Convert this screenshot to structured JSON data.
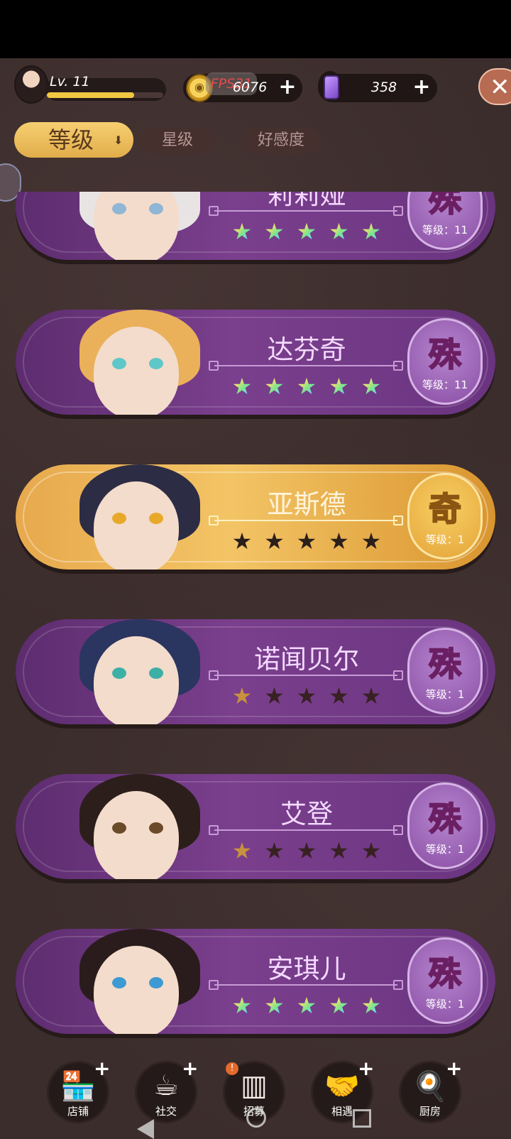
{
  "hud": {
    "level_text": "Lv. 11",
    "exp_fraction": 0.75,
    "fps_text": "FPS31",
    "coins": "6076",
    "gems": "358",
    "plus": "+",
    "close": "✕"
  },
  "sort_tabs": {
    "active": "等级",
    "active_arrow": "⬇",
    "star": "星级",
    "affinity": "好感度"
  },
  "characters": [
    {
      "name": "莉莉娅",
      "rank": "殊",
      "level_label": "等级：11",
      "stars_filled": 5,
      "star_type": "rainbow",
      "theme": "purple",
      "hair": "#e8e4e4",
      "eye": "#8fb6d4"
    },
    {
      "name": "达芬奇",
      "rank": "殊",
      "level_label": "等级：11",
      "stars_filled": 5,
      "star_type": "rainbow",
      "theme": "purple",
      "hair": "#eab15a",
      "eye": "#5fc7c7"
    },
    {
      "name": "亚斯德",
      "rank": "奇",
      "level_label": "等级：1",
      "stars_filled": 0,
      "star_type": "bronze",
      "theme": "gold",
      "hair": "#2c2c44",
      "eye": "#e8a92a"
    },
    {
      "name": "诺闻贝尔",
      "rank": "殊",
      "level_label": "等级：1",
      "stars_filled": 1,
      "star_type": "bronze",
      "theme": "purple",
      "hair": "#2a3560",
      "eye": "#3db0a6"
    },
    {
      "name": "艾登",
      "rank": "殊",
      "level_label": "等级：1",
      "stars_filled": 1,
      "star_type": "bronze",
      "theme": "purple",
      "hair": "#2c1e1a",
      "eye": "#6b4a2a"
    },
    {
      "name": "安琪儿",
      "rank": "殊",
      "level_label": "等级：1",
      "stars_filled": 5,
      "star_type": "rainbow",
      "theme": "purple",
      "hair": "#2a1c1c",
      "eye": "#3e9ad2"
    }
  ],
  "nav": [
    {
      "label": "店铺",
      "glyph": "🏪",
      "plus": "+"
    },
    {
      "label": "社交",
      "glyph": "☕",
      "plus": "+"
    },
    {
      "label": "招募",
      "glyph": "▥",
      "alert": "!"
    },
    {
      "label": "相遇",
      "glyph": "🤝",
      "plus": "+"
    },
    {
      "label": "厨房",
      "glyph": "🍳",
      "plus": "+"
    }
  ],
  "colors": {
    "background": "#3b2d2c",
    "card_purple": "#7a3f8d",
    "card_gold": "#f3c465",
    "accent_yellow": "#f2c842"
  }
}
